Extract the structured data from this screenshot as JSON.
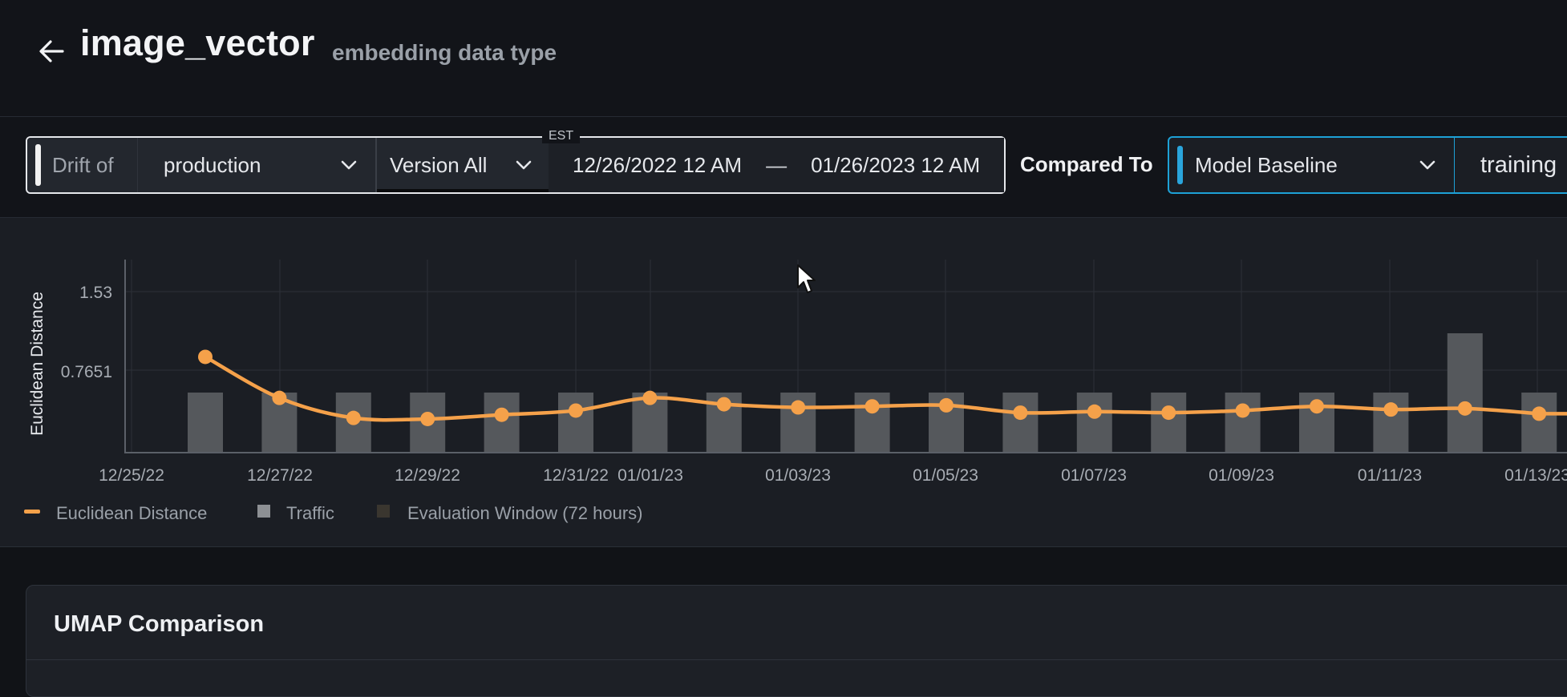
{
  "header": {
    "title": "image_vector",
    "subtitle": "embedding data type"
  },
  "filters": {
    "timezone": "EST",
    "drift_of_label": "Drift of",
    "environment": "production",
    "version": "Version All",
    "start": "12/26/2022 12 AM",
    "separator": "—",
    "end": "01/26/2023 12 AM",
    "compared_to_label": "Compared To",
    "baseline": "Model Baseline",
    "baseline_env": "training"
  },
  "chart_data": {
    "type": "line",
    "ylabel": "Euclidean Distance",
    "yticks": [
      "1.53",
      "0.7651"
    ],
    "xticks": [
      "12/25/22",
      "12/27/22",
      "12/29/22",
      "12/31/22",
      "01/01/23",
      "01/03/23",
      "01/05/23",
      "01/07/23",
      "01/09/23",
      "01/11/23",
      "01/13/23"
    ],
    "series": [
      {
        "name": "Euclidean Distance",
        "color": "#f5a14a",
        "x": [
          "12/26",
          "12/27",
          "12/28",
          "12/29",
          "12/30",
          "12/31",
          "01/01",
          "01/02",
          "01/03",
          "01/04",
          "01/05",
          "01/06",
          "01/07",
          "01/08",
          "01/09",
          "01/10",
          "01/11",
          "01/12",
          "01/13"
        ],
        "values": [
          0.91,
          0.52,
          0.33,
          0.32,
          0.36,
          0.4,
          0.52,
          0.46,
          0.43,
          0.44,
          0.45,
          0.38,
          0.39,
          0.38,
          0.4,
          0.44,
          0.41,
          0.42,
          0.37
        ]
      },
      {
        "name": "Traffic",
        "color": "#5a5d61",
        "x": [
          "12/26",
          "12/27",
          "12/28",
          "12/29",
          "12/30",
          "12/31",
          "01/01",
          "01/02",
          "01/03",
          "01/04",
          "01/05",
          "01/06",
          "01/07",
          "01/08",
          "01/09",
          "01/10",
          "01/11",
          "01/12",
          "01/13"
        ],
        "values": [
          1,
          1,
          1,
          1,
          1,
          1,
          1,
          1,
          1,
          1,
          1,
          1,
          1,
          1,
          1,
          1,
          1,
          2,
          1
        ]
      }
    ],
    "legend": [
      "Euclidean Distance",
      "Traffic",
      "Evaluation Window (72 hours)"
    ],
    "legend_placement": "bottom-left",
    "grid": true
  },
  "umap": {
    "title": "UMAP Comparison"
  }
}
